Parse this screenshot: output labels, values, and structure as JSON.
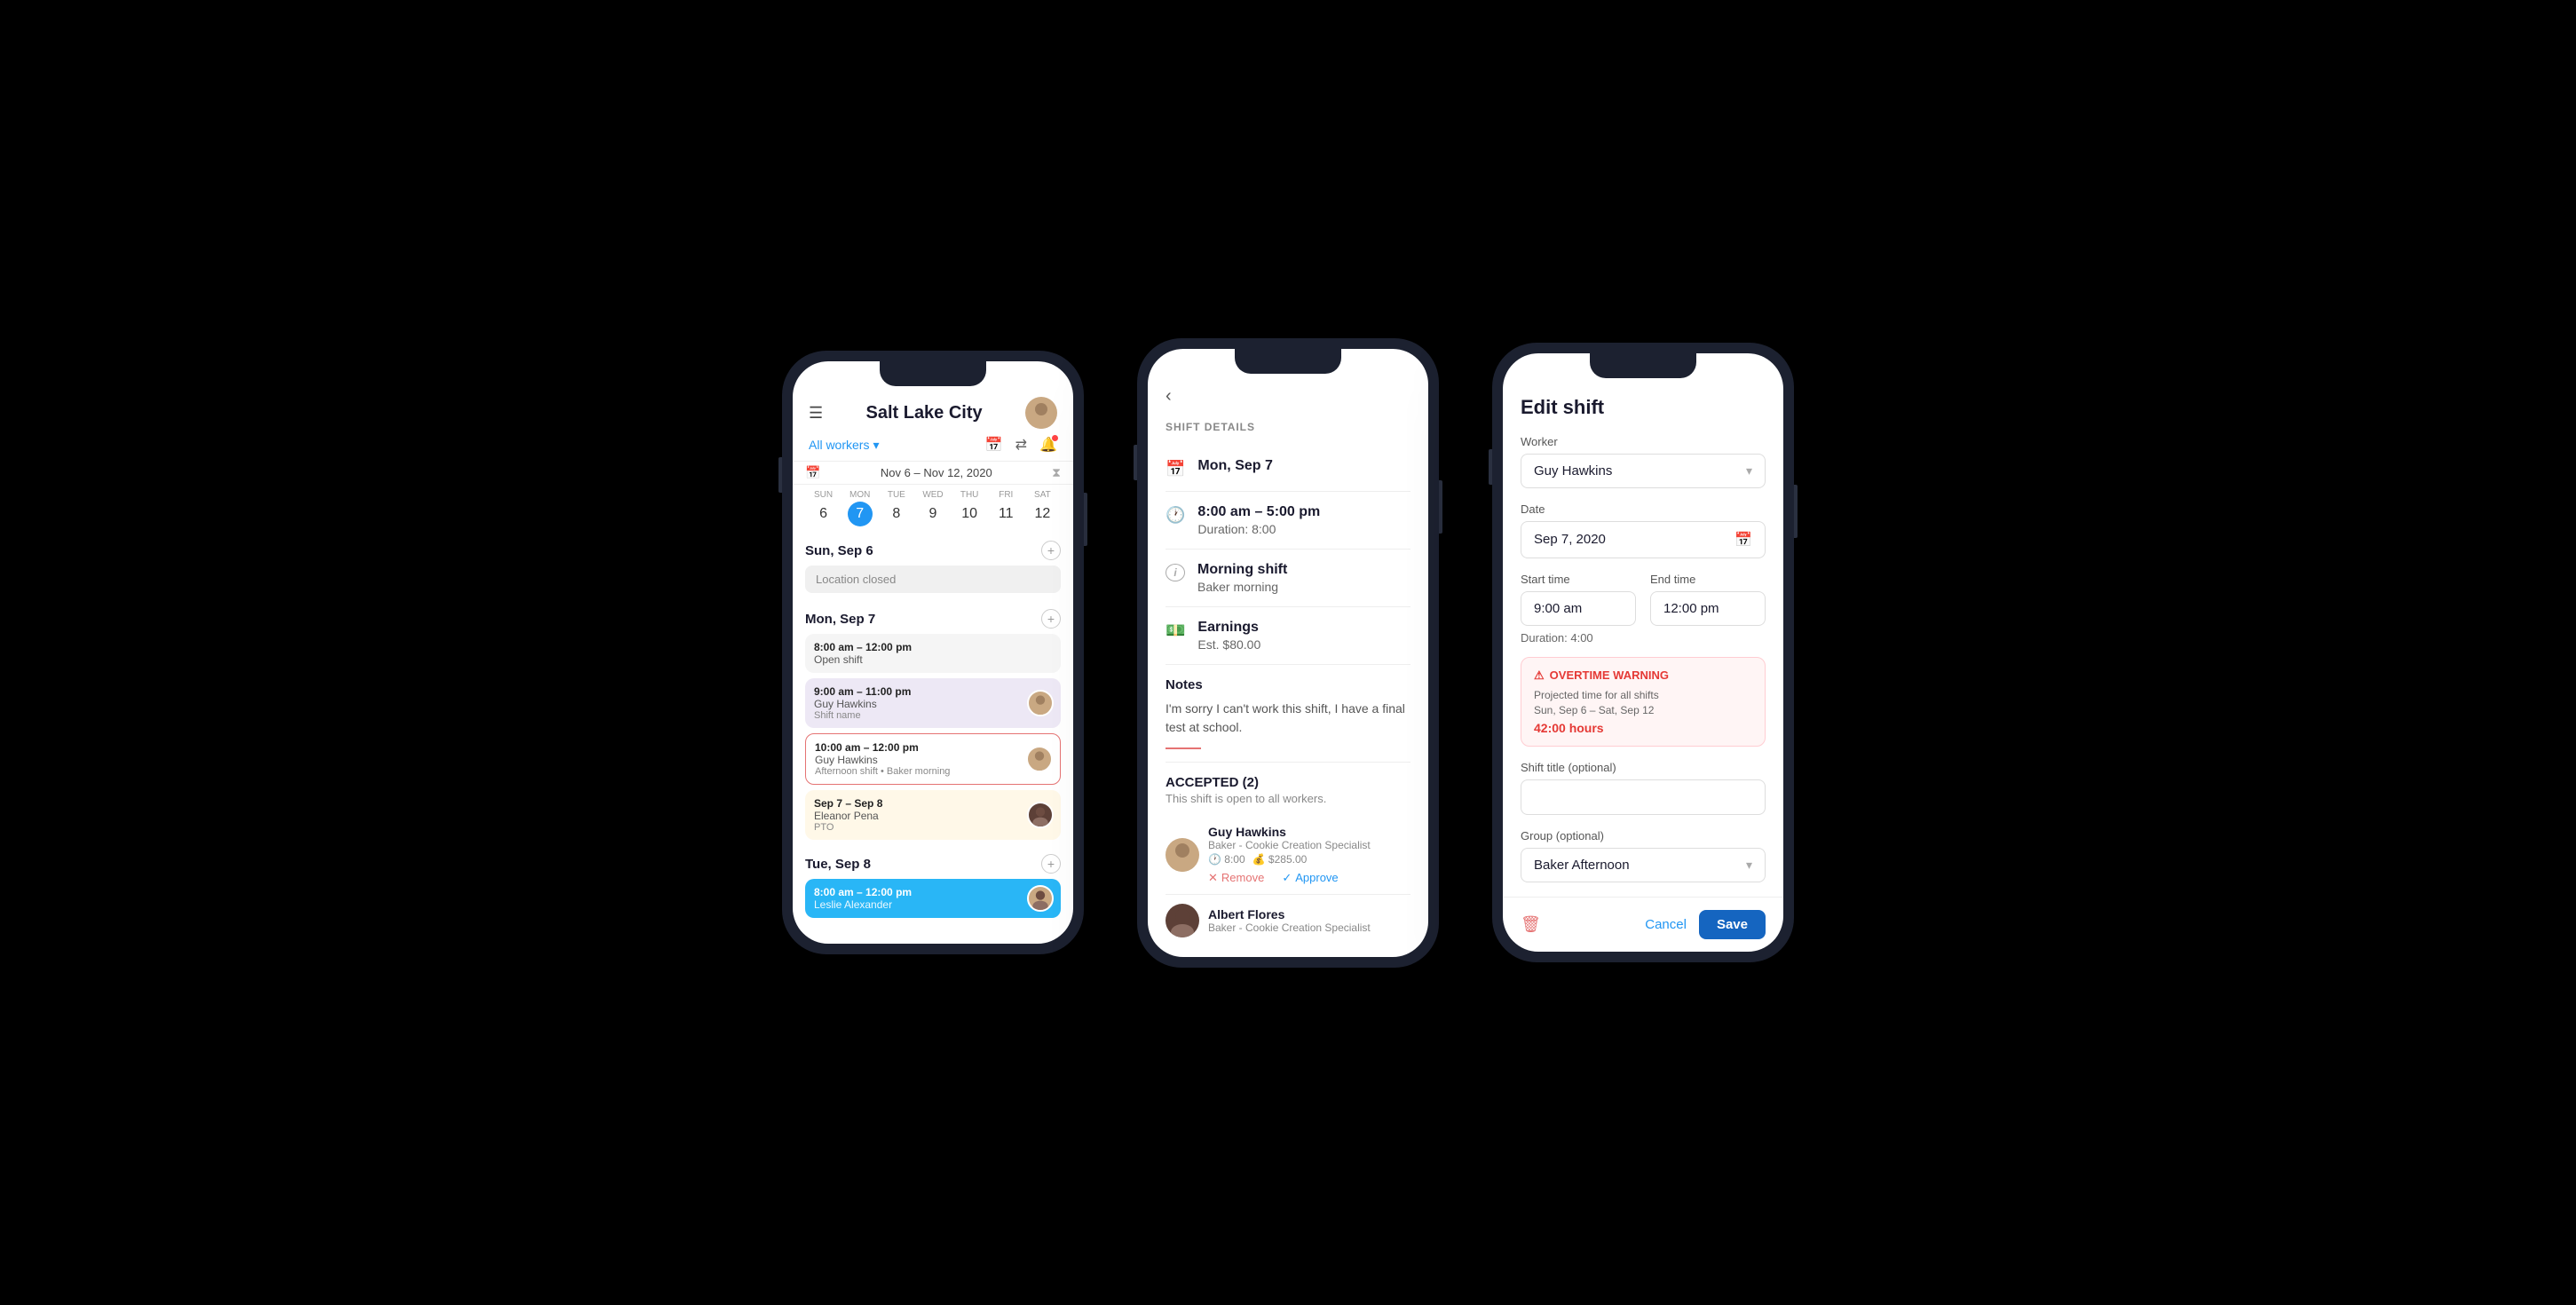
{
  "phone1": {
    "header": {
      "menu_icon": "☰",
      "title": "Salt Lake City",
      "avatar_initials": "👤"
    },
    "filters": {
      "workers_label": "All workers",
      "chevron": "▾"
    },
    "week_nav": {
      "prev": "‹",
      "next": "›",
      "range": "Nov 6 – Nov 12, 2020"
    },
    "days": [
      {
        "label": "SUN",
        "num": "6",
        "active": false
      },
      {
        "label": "MON",
        "num": "7",
        "active": true
      },
      {
        "label": "TUE",
        "num": "8",
        "active": false
      },
      {
        "label": "WED",
        "num": "9",
        "active": false
      },
      {
        "label": "THU",
        "num": "10",
        "active": false
      },
      {
        "label": "FRI",
        "num": "11",
        "active": false
      },
      {
        "label": "SAT",
        "num": "12",
        "active": false
      }
    ],
    "sections": [
      {
        "title": "Sun, Sep 6",
        "items": [
          {
            "type": "closed",
            "label": "Location closed"
          }
        ]
      },
      {
        "title": "Mon, Sep 7",
        "items": [
          {
            "type": "gray",
            "time": "8:00 am – 12:00 pm",
            "name": "Open shift",
            "sub": ""
          },
          {
            "type": "purple",
            "time": "9:00 am – 11:00 pm",
            "name": "Guy Hawkins",
            "sub": "Shift name",
            "avatar": "guy"
          },
          {
            "type": "outline",
            "time": "10:00 am – 12:00 pm",
            "name": "Guy Hawkins",
            "sub": "Afternoon shift • Baker morning",
            "avatar": "guy"
          },
          {
            "type": "yellow",
            "time": "Sep 7 – Sep 8",
            "name": "Eleanor Pena",
            "sub": "PTO",
            "avatar": "eleanor"
          }
        ]
      },
      {
        "title": "Tue, Sep 8",
        "items": [
          {
            "type": "blue",
            "time": "8:00 am – 12:00 pm",
            "name": "Leslie Alexander",
            "sub": "",
            "avatar": "leslie"
          }
        ]
      }
    ]
  },
  "phone2": {
    "back_icon": "‹",
    "section_title": "SHIFT DETAILS",
    "rows": [
      {
        "icon": "📅",
        "title": "Mon, Sep 7",
        "sub": ""
      },
      {
        "icon": "🕐",
        "title": "8:00 am – 5:00 pm",
        "sub": "Duration: 8:00"
      },
      {
        "icon": "ℹ️",
        "title": "Morning shift",
        "sub": "Baker morning"
      },
      {
        "icon": "💰",
        "title": "Earnings",
        "sub": "Est. $80.00"
      }
    ],
    "notes": {
      "label": "Notes",
      "text": "I'm sorry I can't work this shift, I have a final test at school."
    },
    "accepted": {
      "title": "ACCEPTED (2)",
      "sub": "This shift is open to all workers.",
      "workers": [
        {
          "name": "Guy Hawkins",
          "role": "Baker - Cookie Creation Specialist",
          "hours": "8:00",
          "pay": "$285.00",
          "avatar": "guy"
        },
        {
          "name": "Albert Flores",
          "role": "Baker - Cookie Creation Specialist",
          "avatar": "albert"
        }
      ]
    },
    "actions": {
      "remove": "Remove",
      "approve": "Approve"
    }
  },
  "phone3": {
    "title": "Edit shift",
    "worker_label": "Worker",
    "worker_value": "Guy Hawkins",
    "date_label": "Date",
    "date_value": "Sep 7, 2020",
    "start_time_label": "Start time",
    "start_time_value": "9:00 am",
    "end_time_label": "End time",
    "end_time_value": "12:00 pm",
    "duration_label": "Duration: 4:00",
    "warning": {
      "title": "OVERTIME WARNING",
      "text": "Projected time for all shifts",
      "period": "Sun, Sep 6 – Sat, Sep 12",
      "hours": "42:00 hours"
    },
    "shift_title_label": "Shift title (optional)",
    "shift_title_placeholder": "",
    "group_label": "Group (optional)",
    "group_value": "Baker Afternoon",
    "buttons": {
      "cancel": "Cancel",
      "save": "Save",
      "delete_icon": "🗑"
    }
  }
}
